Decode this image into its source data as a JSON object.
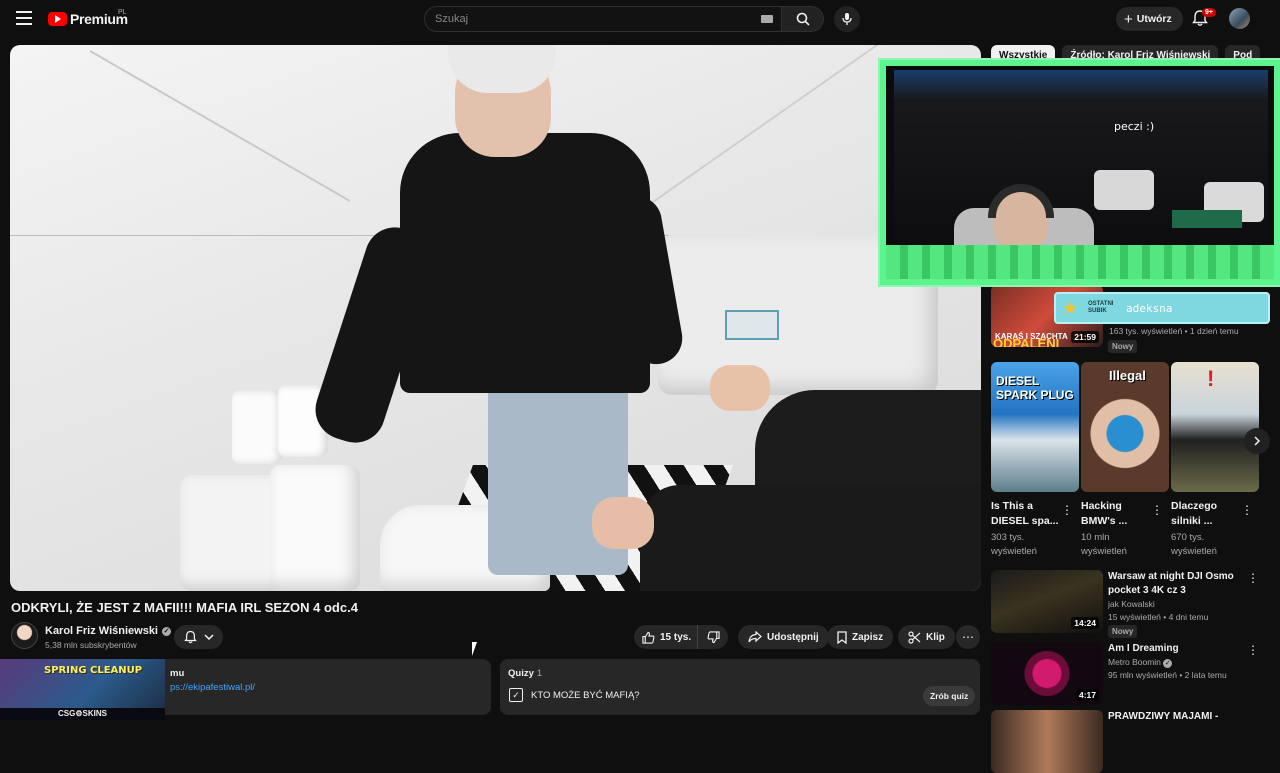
{
  "topbar": {
    "logo_text": "Premium",
    "logo_country": "PL",
    "search_placeholder": "Szukaj",
    "create_label": "Utwórz",
    "notification_count": "9+"
  },
  "filters": [
    "Wszystkie",
    "Źródło: Karol Friz Wiśniewski",
    "Pod"
  ],
  "overlay": {
    "caption": "peczi :)",
    "sub_widget_label": "OSTATNI SUBIK",
    "sub_widget_name": "adeksna"
  },
  "video": {
    "title": "ODKRYLI, ŻE JEST Z MAFII!!! MAFIA IRL SEZON 4 odc.4",
    "channel": "Karol Friz Wiśniewski",
    "subscribers": "5,38 mln subskrybentów",
    "likes": "15 tys.",
    "share_label": "Udostępnij",
    "save_label": "Zapisz",
    "clip_label": "Klip"
  },
  "description": {
    "label_fragment": "mu",
    "link": "ps://ekipafestiwal.pl/",
    "ad_title": "SPRING CLEANUP",
    "ad_brand": "CSG⚙SKINS"
  },
  "quiz": {
    "label": "Quizy",
    "count": "1",
    "question": "KTO MOŻE BYĆ MAFIĄ?",
    "button": "Zrób quiz"
  },
  "first_rec": {
    "thumb_text": "KARAŚ I SZACHTA",
    "thumb_big": "ODPALENI",
    "duration": "21:59",
    "meta": "163 tys. wyświetleń • 1 dzień temu",
    "badge": "Nowy"
  },
  "shorts": [
    {
      "title": "Is This a DIESEL spa...",
      "views": "303 tys. wyświetleń",
      "thumb_text": "DIESEL SPARK PLUG"
    },
    {
      "title": "Hacking BMW's ...",
      "views": "10 mln wyświetleń",
      "thumb_text": "Illegal"
    },
    {
      "title": "Dlaczego silniki ...",
      "views": "670 tys. wyświetleń",
      "thumb_text": ""
    }
  ],
  "recs": [
    {
      "title": "Warsaw at night  DJI Osmo pocket 3 4K cz  3",
      "channel": "jak Kowalski",
      "meta": "15 wyświetleń • 4 dni temu",
      "badge": "Nowy",
      "duration": "14:24"
    },
    {
      "title": "Am I Dreaming",
      "channel": "Metro Boomin",
      "meta": "95 mln wyświetleń • 2 lata temu",
      "duration": "4:17"
    },
    {
      "title": "PRAWDZIWY MAJAMI -",
      "channel": "",
      "meta": ""
    }
  ]
}
